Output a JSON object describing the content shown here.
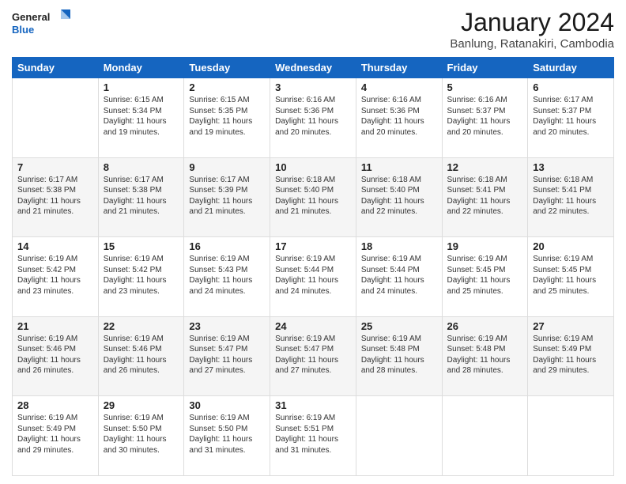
{
  "logo": {
    "text1": "General",
    "text2": "Blue"
  },
  "title": "January 2024",
  "subtitle": "Banlung, Ratanakiri, Cambodia",
  "days_of_week": [
    "Sunday",
    "Monday",
    "Tuesday",
    "Wednesday",
    "Thursday",
    "Friday",
    "Saturday"
  ],
  "weeks": [
    [
      {
        "day": "",
        "info": ""
      },
      {
        "day": "1",
        "info": "Sunrise: 6:15 AM\nSunset: 5:34 PM\nDaylight: 11 hours\nand 19 minutes."
      },
      {
        "day": "2",
        "info": "Sunrise: 6:15 AM\nSunset: 5:35 PM\nDaylight: 11 hours\nand 19 minutes."
      },
      {
        "day": "3",
        "info": "Sunrise: 6:16 AM\nSunset: 5:36 PM\nDaylight: 11 hours\nand 20 minutes."
      },
      {
        "day": "4",
        "info": "Sunrise: 6:16 AM\nSunset: 5:36 PM\nDaylight: 11 hours\nand 20 minutes."
      },
      {
        "day": "5",
        "info": "Sunrise: 6:16 AM\nSunset: 5:37 PM\nDaylight: 11 hours\nand 20 minutes."
      },
      {
        "day": "6",
        "info": "Sunrise: 6:17 AM\nSunset: 5:37 PM\nDaylight: 11 hours\nand 20 minutes."
      }
    ],
    [
      {
        "day": "7",
        "info": "Sunrise: 6:17 AM\nSunset: 5:38 PM\nDaylight: 11 hours\nand 21 minutes."
      },
      {
        "day": "8",
        "info": "Sunrise: 6:17 AM\nSunset: 5:38 PM\nDaylight: 11 hours\nand 21 minutes."
      },
      {
        "day": "9",
        "info": "Sunrise: 6:17 AM\nSunset: 5:39 PM\nDaylight: 11 hours\nand 21 minutes."
      },
      {
        "day": "10",
        "info": "Sunrise: 6:18 AM\nSunset: 5:40 PM\nDaylight: 11 hours\nand 21 minutes."
      },
      {
        "day": "11",
        "info": "Sunrise: 6:18 AM\nSunset: 5:40 PM\nDaylight: 11 hours\nand 22 minutes."
      },
      {
        "day": "12",
        "info": "Sunrise: 6:18 AM\nSunset: 5:41 PM\nDaylight: 11 hours\nand 22 minutes."
      },
      {
        "day": "13",
        "info": "Sunrise: 6:18 AM\nSunset: 5:41 PM\nDaylight: 11 hours\nand 22 minutes."
      }
    ],
    [
      {
        "day": "14",
        "info": "Sunrise: 6:19 AM\nSunset: 5:42 PM\nDaylight: 11 hours\nand 23 minutes."
      },
      {
        "day": "15",
        "info": "Sunrise: 6:19 AM\nSunset: 5:42 PM\nDaylight: 11 hours\nand 23 minutes."
      },
      {
        "day": "16",
        "info": "Sunrise: 6:19 AM\nSunset: 5:43 PM\nDaylight: 11 hours\nand 24 minutes."
      },
      {
        "day": "17",
        "info": "Sunrise: 6:19 AM\nSunset: 5:44 PM\nDaylight: 11 hours\nand 24 minutes."
      },
      {
        "day": "18",
        "info": "Sunrise: 6:19 AM\nSunset: 5:44 PM\nDaylight: 11 hours\nand 24 minutes."
      },
      {
        "day": "19",
        "info": "Sunrise: 6:19 AM\nSunset: 5:45 PM\nDaylight: 11 hours\nand 25 minutes."
      },
      {
        "day": "20",
        "info": "Sunrise: 6:19 AM\nSunset: 5:45 PM\nDaylight: 11 hours\nand 25 minutes."
      }
    ],
    [
      {
        "day": "21",
        "info": "Sunrise: 6:19 AM\nSunset: 5:46 PM\nDaylight: 11 hours\nand 26 minutes."
      },
      {
        "day": "22",
        "info": "Sunrise: 6:19 AM\nSunset: 5:46 PM\nDaylight: 11 hours\nand 26 minutes."
      },
      {
        "day": "23",
        "info": "Sunrise: 6:19 AM\nSunset: 5:47 PM\nDaylight: 11 hours\nand 27 minutes."
      },
      {
        "day": "24",
        "info": "Sunrise: 6:19 AM\nSunset: 5:47 PM\nDaylight: 11 hours\nand 27 minutes."
      },
      {
        "day": "25",
        "info": "Sunrise: 6:19 AM\nSunset: 5:48 PM\nDaylight: 11 hours\nand 28 minutes."
      },
      {
        "day": "26",
        "info": "Sunrise: 6:19 AM\nSunset: 5:48 PM\nDaylight: 11 hours\nand 28 minutes."
      },
      {
        "day": "27",
        "info": "Sunrise: 6:19 AM\nSunset: 5:49 PM\nDaylight: 11 hours\nand 29 minutes."
      }
    ],
    [
      {
        "day": "28",
        "info": "Sunrise: 6:19 AM\nSunset: 5:49 PM\nDaylight: 11 hours\nand 29 minutes."
      },
      {
        "day": "29",
        "info": "Sunrise: 6:19 AM\nSunset: 5:50 PM\nDaylight: 11 hours\nand 30 minutes."
      },
      {
        "day": "30",
        "info": "Sunrise: 6:19 AM\nSunset: 5:50 PM\nDaylight: 11 hours\nand 31 minutes."
      },
      {
        "day": "31",
        "info": "Sunrise: 6:19 AM\nSunset: 5:51 PM\nDaylight: 11 hours\nand 31 minutes."
      },
      {
        "day": "",
        "info": ""
      },
      {
        "day": "",
        "info": ""
      },
      {
        "day": "",
        "info": ""
      }
    ]
  ]
}
